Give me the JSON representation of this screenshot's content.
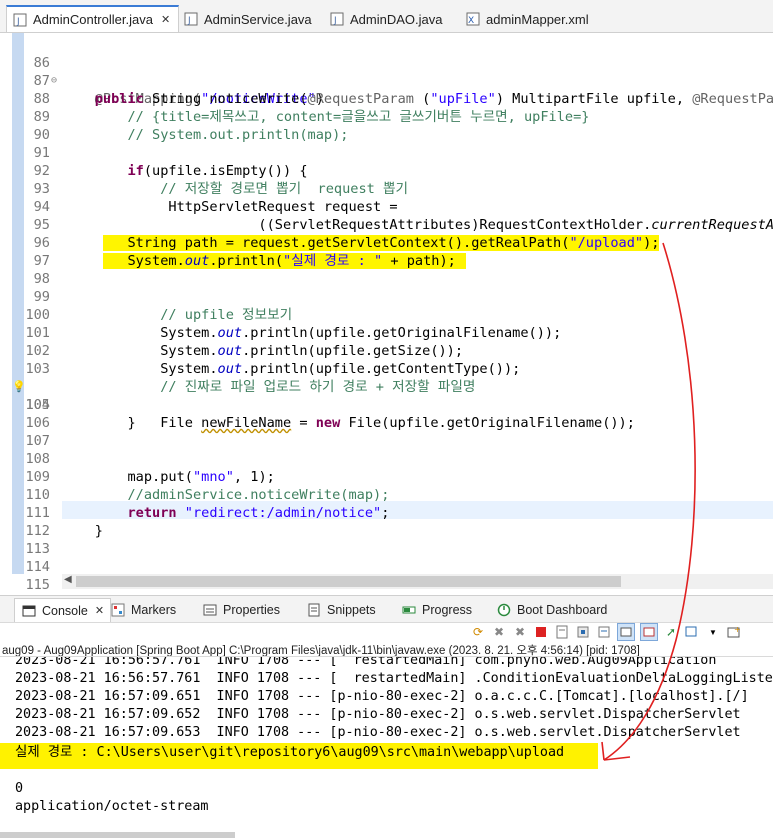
{
  "tabs": [
    {
      "label": "AdminController.java",
      "active": true,
      "icon": "java-file-icon",
      "closable": true
    },
    {
      "label": "AdminService.java",
      "active": false,
      "icon": "java-file-icon",
      "closable": false
    },
    {
      "label": "AdminDAO.java",
      "active": false,
      "icon": "java-file-icon",
      "closable": false
    },
    {
      "label": "adminMapper.xml",
      "active": false,
      "icon": "xml-file-icon",
      "closable": false
    }
  ],
  "editor": {
    "line_numbers": [
      "86",
      "87",
      "88",
      "89",
      "90",
      "91",
      "92",
      "93",
      "94",
      "95",
      "96",
      "97",
      "98",
      "99",
      "100",
      "101",
      "102",
      "103",
      "104",
      "105",
      "106",
      "107",
      "108",
      "109",
      "110",
      "111",
      "112",
      "113",
      "114",
      "115"
    ],
    "lines": {
      "l86_a": "@PostMapping(",
      "l86_b": "\"/noticeWrite\"",
      "l86_c": ")",
      "l87_kw1": "public",
      "l87_a": " String noticeWrite(",
      "l87_ann": "@RequestParam",
      "l87_b": " (",
      "l87_str": "\"upFile\"",
      "l87_c": ") MultipartFile upfile, ",
      "l87_ann2": "@RequestPara",
      "l88": "// {title=제목쓰고, content=글을쓰고 글쓰기버튼 누르면, upFile=}",
      "l89": "// System.out.println(map);",
      "l91_kw": "if",
      "l91_a": "(upfile.isEmpty()) {",
      "l92": "// 저장할 경로면 뽑기  request 뽑기",
      "l93": "HttpServletRequest request =",
      "l94_a": "((ServletRequestAttributes)RequestContextHolder.",
      "l94_b": "currentRequestAt",
      "l95_a": "String path = request.getServletContext().getRealPath(",
      "l95_str": "\"/upload\"",
      "l95_b": ");",
      "l96_a": "System.",
      "l96_out": "out",
      "l96_b": ".println(",
      "l96_str": "\"실제 경로 : \"",
      "l96_c": " + path);",
      "l99": "// upfile 정보보기",
      "l100_a": "System.",
      "l100_out": "out",
      "l100_b": ".println(upfile.getOriginalFilename());",
      "l101_a": "System.",
      "l101_out": "out",
      "l101_b": ".println(upfile.getSize());",
      "l102_a": "System.",
      "l102_out": "out",
      "l102_b": ".println(upfile.getContentType());",
      "l103": "// 진짜로 파일 업로드 하기 경로 + 저장할 파일명",
      "l104_a": "File ",
      "l104_var": "newFileName",
      "l104_b": " = ",
      "l104_kw": "new",
      "l104_c": " File(upfile.getOriginalFilename());",
      "l105": "}",
      "l108_a": "map.put(",
      "l108_str": "\"mno\"",
      "l108_b": ", 1);",
      "l109": "//adminService.noticeWrite(map);",
      "l110_kw": "return",
      "l110_str": "\"redirect:/admin/notice\"",
      "l110_b": ";",
      "l111": "}",
      "l115": "}"
    }
  },
  "console": {
    "tabs": [
      {
        "label": "Console",
        "icon": "console-icon",
        "active": true
      },
      {
        "label": "Markers",
        "icon": "markers-icon",
        "active": false
      },
      {
        "label": "Properties",
        "icon": "properties-icon",
        "active": false
      },
      {
        "label": "Snippets",
        "icon": "snippets-icon",
        "active": false
      },
      {
        "label": "Progress",
        "icon": "progress-icon",
        "active": false
      },
      {
        "label": "Boot Dashboard",
        "icon": "boot-dashboard-icon",
        "active": false
      }
    ],
    "title": "aug09 - Aug09Application [Spring Boot App] C:\\Program Files\\java\\jdk-11\\bin\\javaw.exe  (2023. 8. 21. 오후 4:56:14) [pid: 1708]",
    "output": [
      "2023-08-21 16:56:57.761  INFO 1708 --- [  restartedMain] com.phyho.web.Aug09Application",
      "2023-08-21 16:56:57.761  INFO 1708 --- [  restartedMain] .ConditionEvaluationDeltaLoggingListen",
      "2023-08-21 16:57:09.651  INFO 1708 --- [p-nio-80-exec-2] o.a.c.c.C.[Tomcat].[localhost].[/]",
      "2023-08-21 16:57:09.652  INFO 1708 --- [p-nio-80-exec-2] o.s.web.servlet.DispatcherServlet",
      "2023-08-21 16:57:09.653  INFO 1708 --- [p-nio-80-exec-2] o.s.web.servlet.DispatcherServlet",
      "실제 경로 : C:\\Users\\user\\git\\repository6\\aug09\\src\\main\\webapp\\upload",
      "",
      "0",
      "application/octet-stream"
    ]
  },
  "colors": {
    "highlight": "#fff500",
    "annotation_arrow": "#e02020",
    "keyword": "#7f0055",
    "string": "#2a00ff",
    "comment": "#3f7f5f"
  }
}
